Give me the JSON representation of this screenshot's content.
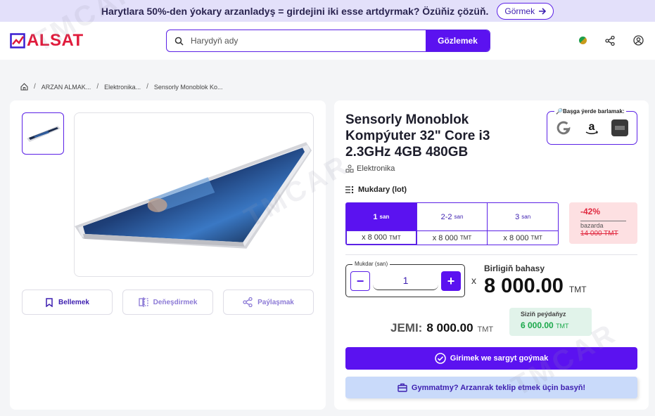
{
  "banner": {
    "text": "Harytlara 50%-den ýokary arzanladyş = girdejini iki esse artdyrmak? Özüňiz çözüň.",
    "button_label": "Görmek"
  },
  "header": {
    "logo_text": "ALSAT",
    "search_placeholder": "Harydyň ady",
    "search_button": "Gözlemek"
  },
  "breadcrumb": [
    "ARZAN ALMAK...",
    "Elektronika...",
    "Sensorly Monoblok Ko..."
  ],
  "product": {
    "title": "Sensorly Monoblok Kompýuter 32\" Core i3 2.3GHz 4GB 480GB",
    "category": "Elektronika",
    "external_search_label": "🔎Başga ýerde barlamak:",
    "quantity_label": "Mukdary (lot)",
    "lots": [
      {
        "qty": "1",
        "unit": "san",
        "price": "x 8 000",
        "currency": "TMT"
      },
      {
        "qty": "2-2",
        "unit": "san",
        "price": "x 8 000",
        "currency": "TMT"
      },
      {
        "qty": "3",
        "unit": "san",
        "price": "x 8 000",
        "currency": "TMT"
      }
    ],
    "discount": {
      "percent": "-42%",
      "label": "bazarda",
      "old_price": "14 000 TMT"
    },
    "stepper": {
      "label": "Mukdar (san)",
      "value": "1"
    },
    "unit_price_label": "Birligiň bahasy",
    "unit_price": "8 000.00",
    "currency": "TMT",
    "total_label": "JEMI:",
    "total_value": "8 000.00",
    "savings_label": "Siziň peýdaňyz",
    "savings_value": "6 000.00",
    "order_button": "Girimek we sargyt goýmak",
    "offer_button": "Gymmatmy? Arzanrak teklip etmek üçin basyň!"
  },
  "actions": {
    "bookmark": "Bellemek",
    "compare": "Deňeşdirmek",
    "share": "Paýlaşmak"
  },
  "colors": {
    "accent": "#5b12f0",
    "brand_red": "#e01b3c",
    "discount_bg": "#fde0e2",
    "savings_bg": "#e1f3ea"
  }
}
